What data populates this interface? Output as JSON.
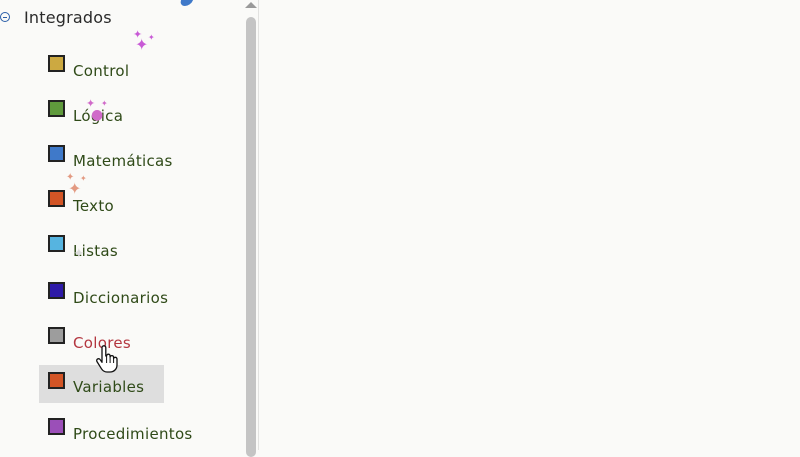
{
  "tree": {
    "title": "Integrados",
    "toggle_icon": "collapse-circle-icon"
  },
  "categories": [
    {
      "label": "Control",
      "color": "#cca941",
      "id": "control"
    },
    {
      "label": "Lógica",
      "color": "#5f9a3c",
      "id": "logica"
    },
    {
      "label": "Matemáticas",
      "color": "#3f79c9",
      "id": "matematicas"
    },
    {
      "label": "Texto",
      "color": "#d35526",
      "id": "texto"
    },
    {
      "label": "Listas",
      "color": "#56b4e0",
      "id": "listas"
    },
    {
      "label": "Diccionarios",
      "color": "#2e1aa8",
      "id": "diccionarios"
    },
    {
      "label": "Colores",
      "color": "#9d9d9d",
      "id": "colores",
      "state": "hover"
    },
    {
      "label": "Variables",
      "color": "#d35526",
      "id": "variables",
      "state": "selected"
    },
    {
      "label": "Procedimientos",
      "color": "#9b4fb8",
      "id": "procedimientos"
    }
  ],
  "colors": {
    "label": "#2f4a18",
    "hover_label": "#b3363f",
    "selected_bg": "#dedede",
    "scroll_thumb": "#c4c4c4",
    "background": "#fafaf8"
  },
  "cursor": {
    "icon": "hand-pointer-icon"
  }
}
